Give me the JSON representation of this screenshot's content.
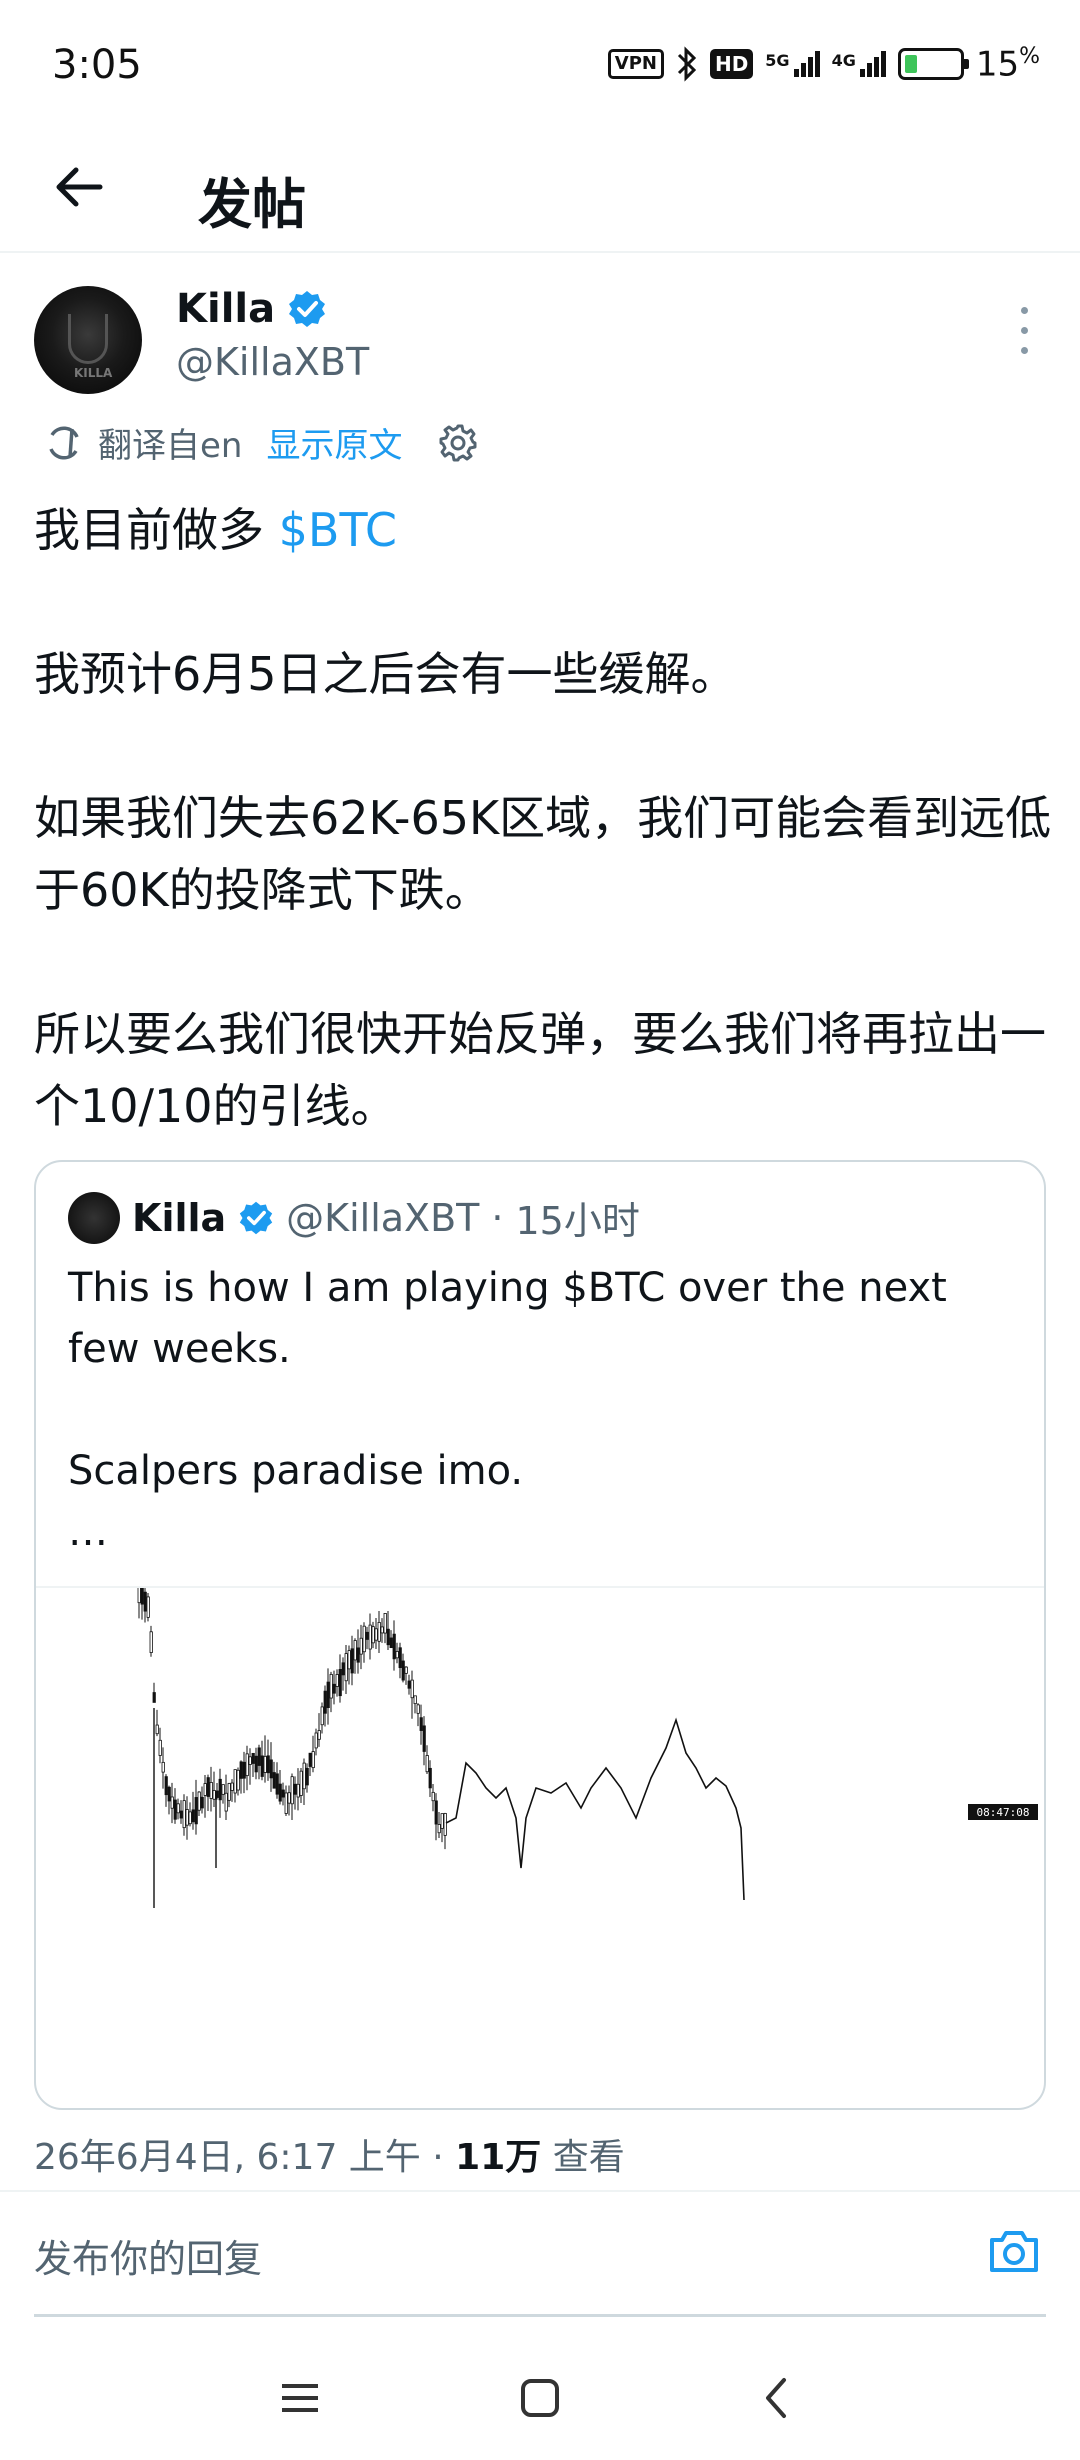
{
  "status_bar": {
    "time": "3:05",
    "vpn": "VPN",
    "hd": "HD",
    "net1": "5G",
    "net2": "4G",
    "battery": "15",
    "battery_unit": "%"
  },
  "header": {
    "title": "发帖"
  },
  "author": {
    "name": "Killa",
    "handle": "@KillaXBT",
    "avatar_text": "KILLA"
  },
  "translation": {
    "label": "翻译自en",
    "show_original": "显示原文"
  },
  "tweet": {
    "line1_prefix": "我目前做多 ",
    "cashtag": "$BTC",
    "p2": "我预计6月5日之后会有一些缓解。",
    "p3": "如果我们失去62K-65K区域，我们可能会看到远低于60K的投降式下跌。",
    "p4": "所以要么我们很快开始反弹，要么我们将再拉出一个10/10的引线。"
  },
  "quote": {
    "name": "Killa",
    "handle": "@KillaXBT",
    "separator": "·",
    "time": "15小时",
    "line1": "This is how I am playing $BTC over the next few weeks.",
    "line2": "",
    "line3": "Scalpers paradise imo.",
    "line4": "…",
    "chart_label": "08:47:08"
  },
  "meta": {
    "date": "26年6月4日, 6:17 上午",
    "separator": "·",
    "views": "11万",
    "views_label": "查看"
  },
  "reply": {
    "placeholder": "发布你的回复"
  },
  "colors": {
    "accent": "#1d9bf0",
    "text": "#0f1419",
    "muted": "#536471",
    "border": "#cfd9de"
  }
}
